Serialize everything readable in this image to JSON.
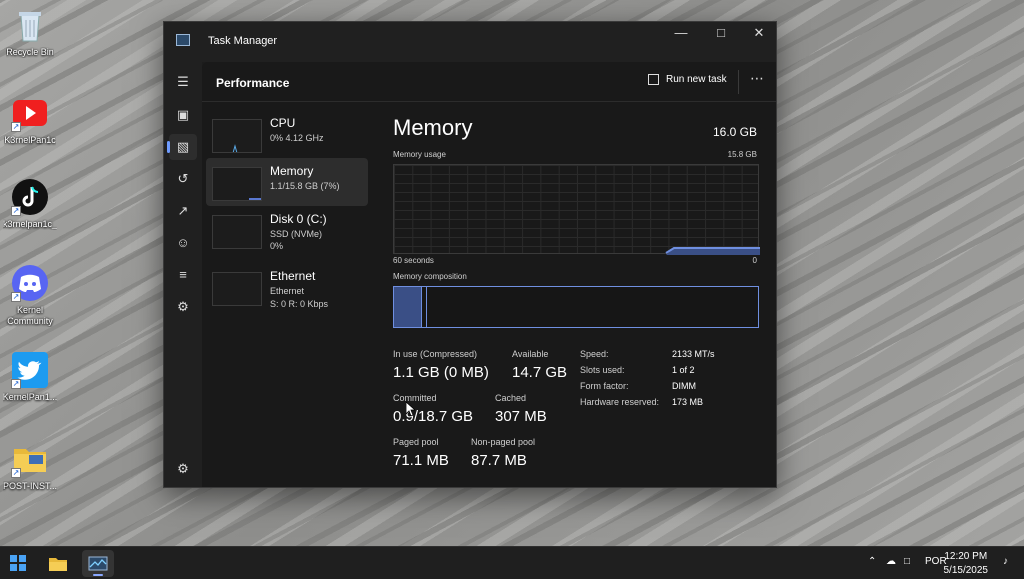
{
  "desktop": {
    "icons": [
      {
        "label": "Recycle Bin"
      },
      {
        "label": "K3rnelPan1c"
      },
      {
        "label": "k3rnelpan1c_"
      },
      {
        "label": "Kernel Community"
      },
      {
        "label": "KernelPan1..."
      },
      {
        "label": "POST-INST..."
      }
    ]
  },
  "window": {
    "title": "Task Manager",
    "header": {
      "title": "Performance",
      "run_task_label": "Run new task",
      "more_label": "⋯"
    },
    "resources": [
      {
        "name": "CPU",
        "line1": "0%  4.12 GHz",
        "line2": ""
      },
      {
        "name": "Memory",
        "line1": "1.1/15.8 GB (7%)",
        "line2": ""
      },
      {
        "name": "Disk 0 (C:)",
        "line1": "SSD (NVMe)",
        "line2": "0%"
      },
      {
        "name": "Ethernet",
        "line1": "Ethernet",
        "line2": "S: 0  R: 0 Kbps"
      }
    ],
    "detail": {
      "title": "Memory",
      "total": "16.0 GB",
      "usage_label": "Memory usage",
      "usage_max": "15.8 GB",
      "time_left": "60 seconds",
      "time_right": "0",
      "composition_label": "Memory composition",
      "stats": {
        "in_use_label": "In use (Compressed)",
        "in_use_value": "1.1 GB (0 MB)",
        "available_label": "Available",
        "available_value": "14.7 GB",
        "committed_label": "Committed",
        "committed_value": "0.9/18.7 GB",
        "cached_label": "Cached",
        "cached_value": "307 MB",
        "paged_label": "Paged pool",
        "paged_value": "71.1 MB",
        "nonpaged_label": "Non-paged pool",
        "nonpaged_value": "87.7 MB"
      },
      "specs": [
        {
          "label": "Speed:",
          "value": "2133 MT/s"
        },
        {
          "label": "Slots used:",
          "value": "1 of 2"
        },
        {
          "label": "Form factor:",
          "value": "DIMM"
        },
        {
          "label": "Hardware reserved:",
          "value": "173 MB"
        }
      ]
    }
  },
  "taskbar": {
    "language": "POR",
    "time": "12:20 PM",
    "date": "5/15/2025"
  },
  "colors": {
    "accent": "#6f8fe0",
    "window_bg": "#191919"
  }
}
